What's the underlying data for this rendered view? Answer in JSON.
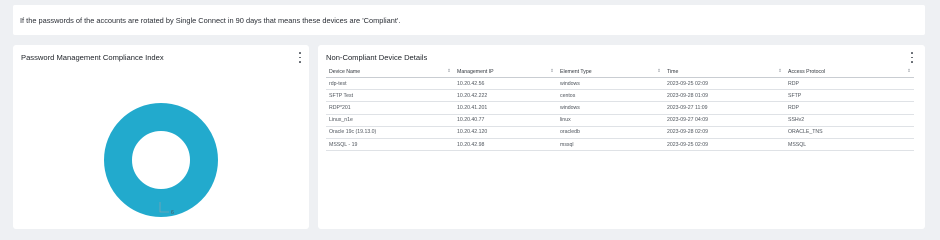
{
  "banner": {
    "text": "If the passwords of the accounts are rotated by Single Connect in 90 days that means these devices are 'Compliant'."
  },
  "compliance_card": {
    "title": "Password Management Compliance Index",
    "donut_color": "#22aacd",
    "label": "6"
  },
  "chart_data": {
    "type": "pie",
    "style": "donut",
    "slices": [
      {
        "value": 6,
        "label": "6",
        "color": "#22aacd"
      }
    ]
  },
  "devices_card": {
    "title": "Non-Compliant Device Details",
    "columns": [
      "Device Name",
      "Management IP",
      "Element Type",
      "Time",
      "Access Protocol"
    ],
    "rows": [
      [
        "rdp-test",
        "10.20.42.56",
        "windows",
        "2023-09-25 02:09",
        "RDP"
      ],
      [
        "SFTP Test",
        "10.20.42.222",
        "centos",
        "2023-09-28 01:09",
        "SFTP"
      ],
      [
        "RDP*201",
        "10.20.41.201",
        "windows",
        "2023-09-27 11:09",
        "RDP"
      ],
      [
        "Linux_n1e",
        "10.20.40.77",
        "linux",
        "2023-09-27 04:09",
        "SSHv2"
      ],
      [
        "Oracle 19c (19.13.0)",
        "10.20.42.120",
        "oracledb",
        "2023-09-28 02:09",
        "ORACLE_TNS"
      ],
      [
        "MSSQL - 19",
        "10.20.42.98",
        "mssql",
        "2023-09-25 02:09",
        "MSSQL"
      ]
    ]
  }
}
